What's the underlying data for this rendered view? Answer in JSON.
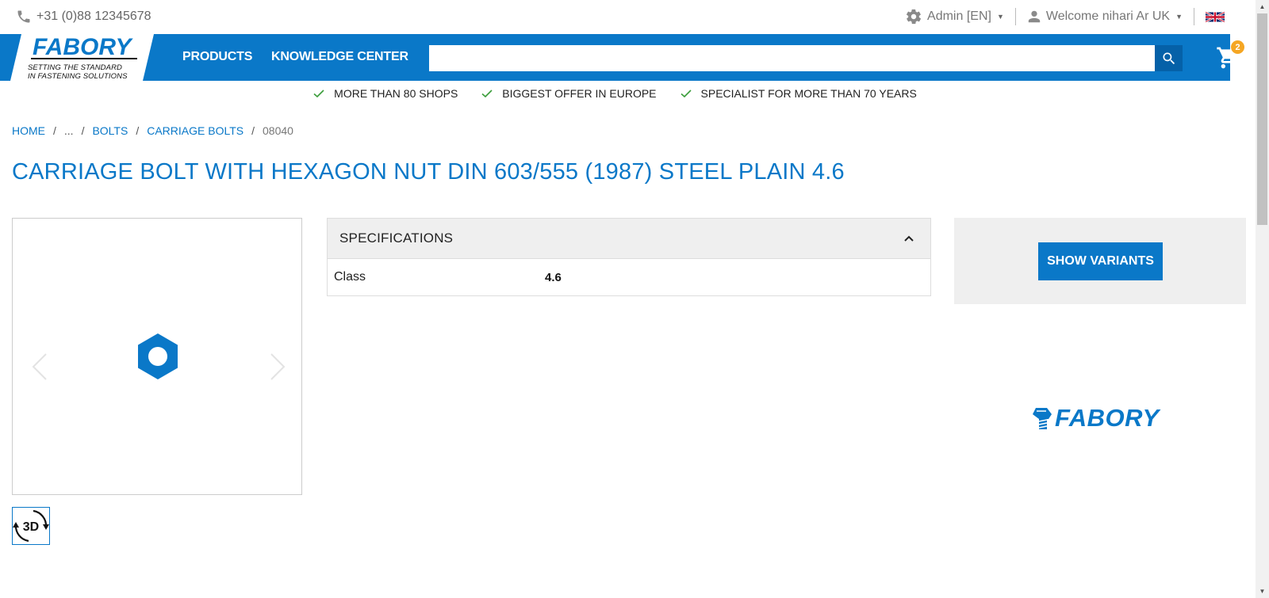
{
  "topbar": {
    "phone": "+31 (0)88 12345678",
    "admin_label": "Admin [EN]",
    "welcome_label": "Welcome nihari Ar UK"
  },
  "nav": {
    "logo_word": "FABORY",
    "logo_tagline_1": "SETTING THE STANDARD",
    "logo_tagline_2": "IN FASTENING SOLUTIONS",
    "products": "PRODUCTS",
    "knowledge_center": "KNOWLEDGE CENTER",
    "search_value": "",
    "cart_count": "2"
  },
  "usps": [
    "MORE THAN 80 SHOPS",
    "BIGGEST OFFER IN EUROPE",
    "SPECIALIST FOR MORE THAN 70 YEARS"
  ],
  "breadcrumb": {
    "home": "HOME",
    "ellipsis": "...",
    "bolts": "BOLTS",
    "carriage_bolts": "CARRIAGE BOLTS",
    "current": "08040",
    "separator": "/"
  },
  "product": {
    "title": "CARRIAGE BOLT WITH HEXAGON NUT DIN 603/555 (1987) STEEL PLAIN 4.6",
    "thumb_label": "3D"
  },
  "specs": {
    "heading": "SPECIFICATIONS",
    "rows": [
      {
        "label": "Class",
        "value": "4.6"
      }
    ]
  },
  "variants": {
    "button": "SHOW VARIANTS"
  },
  "brand": {
    "word": "FABORY"
  },
  "colors": {
    "brand_blue": "#0a78c8",
    "dark_blue": "#0561a8",
    "badge_orange": "#f5a623",
    "check_green": "#3a9d3a"
  }
}
